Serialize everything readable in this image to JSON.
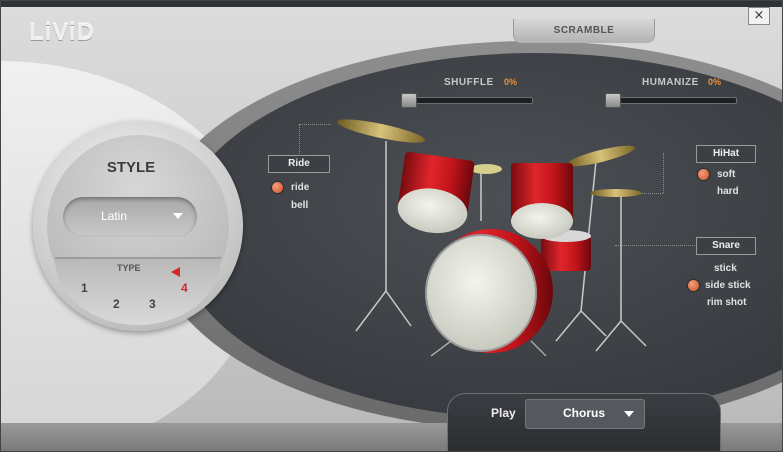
{
  "app": {
    "logo": "LiViD",
    "close_glyph": "×"
  },
  "header": {
    "scramble_label": "SCRAMBLE"
  },
  "sliders": {
    "shuffle": {
      "label": "SHUFFLE",
      "value": "0%",
      "level": 0
    },
    "humanize": {
      "label": "HUMANIZE",
      "value": "0%",
      "level": 0
    }
  },
  "style": {
    "title": "STYLE",
    "selected": "Latin",
    "type_label": "TYPE",
    "types": [
      "1",
      "2",
      "3",
      "4"
    ],
    "active_type": "4"
  },
  "ride": {
    "label": "Ride",
    "options": [
      "ride",
      "bell"
    ],
    "selected": "ride"
  },
  "hihat": {
    "label": "HiHat",
    "options": [
      "soft",
      "hard"
    ],
    "selected": "soft"
  },
  "snare": {
    "label": "Snare",
    "options": [
      "stick",
      "side stick",
      "rim shot"
    ],
    "selected": "side stick"
  },
  "play": {
    "label": "Play",
    "selected": "Chorus"
  },
  "colors": {
    "accent": "#f09030",
    "drum_red": "#c8141a",
    "radio": "#d0603a",
    "active_type": "#d22a2a"
  },
  "icons": {
    "close": "close-icon",
    "dropdown": "chevron-down-icon",
    "drums": "drum-kit-icon"
  }
}
